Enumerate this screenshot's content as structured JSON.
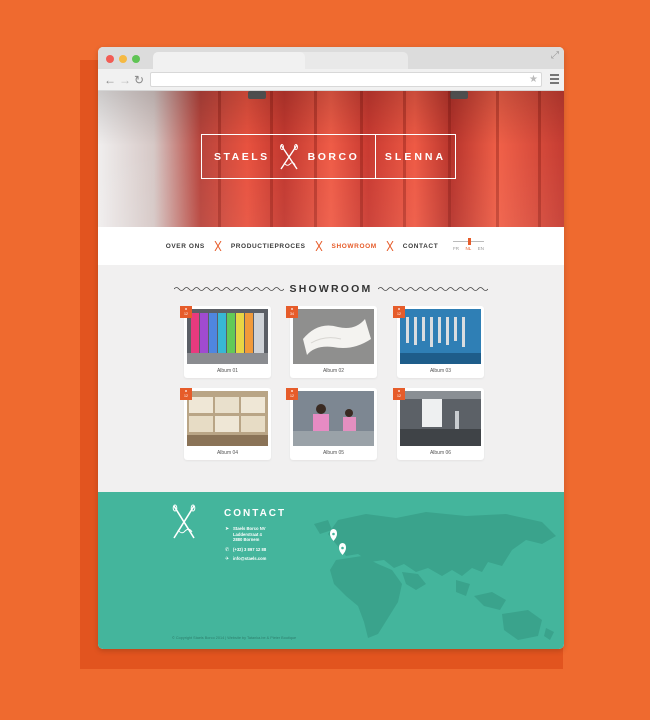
{
  "browser": {
    "url": "",
    "colors": {
      "close": "#f25c54",
      "minimize": "#f5b942",
      "zoom": "#5fc454"
    }
  },
  "hero": {
    "brand_left_1": "STAELS",
    "brand_left_2": "BORCO",
    "brand_right": "SLENNA"
  },
  "nav": {
    "items": [
      {
        "label": "OVER ONS",
        "active": false
      },
      {
        "label": "PRODUCTIEPROCES",
        "active": false
      },
      {
        "label": "SHOWROOM",
        "active": true
      },
      {
        "label": "CONTACT",
        "active": false
      }
    ],
    "languages": [
      "FR",
      "NL",
      "EN"
    ],
    "selected_language": "NL"
  },
  "showroom": {
    "title": "SHOWROOM",
    "albums": [
      {
        "caption": "Album 01",
        "count": "12"
      },
      {
        "caption": "Album 02",
        "count": "34"
      },
      {
        "caption": "Album 03",
        "count": "12"
      },
      {
        "caption": "Album 04",
        "count": "12"
      },
      {
        "caption": "Album 05",
        "count": "12"
      },
      {
        "caption": "Album 06",
        "count": "12"
      }
    ]
  },
  "footer": {
    "title": "CONTACT",
    "address": [
      "Staels Borco NV",
      "Ladderstraat 4",
      "2880 Bornem"
    ],
    "phone": "(+32) 3 897 12 88",
    "email": "info@staels.com",
    "copyright": "© Copyright Staels Borco 2014  |  Website by Tatanka.be & Pieter Boutique"
  },
  "theme": {
    "accent": "#e65c2a",
    "footer_bg": "#44b59c",
    "page_bg": "#ef6a2f"
  }
}
